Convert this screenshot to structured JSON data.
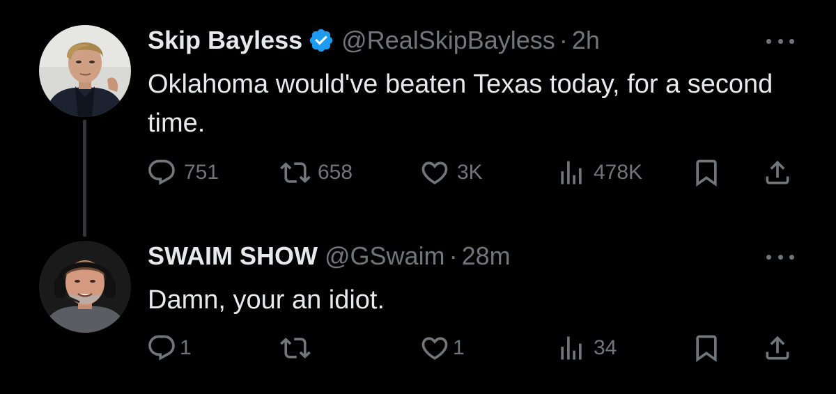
{
  "tweets": [
    {
      "display_name": "Skip Bayless",
      "verified": true,
      "handle": "@RealSkipBayless",
      "separator": "·",
      "time": "2h",
      "text": "Oklahoma would've beaten Texas today, for a second time.",
      "metrics": {
        "replies": "751",
        "retweets": "658",
        "likes": "3K",
        "views": "478K"
      }
    },
    {
      "display_name": "SWAIM SHOW",
      "verified": false,
      "handle": "@GSwaim",
      "separator": "·",
      "time": "28m",
      "text": "Damn, your an idiot.",
      "metrics": {
        "replies": "1",
        "retweets": "",
        "likes": "1",
        "views": "34"
      }
    }
  ],
  "icons": {
    "reply": "reply-icon",
    "retweet": "retweet-icon",
    "like": "like-icon",
    "views": "views-icon",
    "bookmark": "bookmark-icon",
    "share": "share-icon",
    "more": "more-icon",
    "verified": "verified-badge-icon"
  },
  "colors": {
    "background": "#000000",
    "primary_text": "#e7e9ea",
    "secondary_text": "#71767b",
    "verified_blue": "#1d9bf0",
    "thread_line": "#333639"
  }
}
